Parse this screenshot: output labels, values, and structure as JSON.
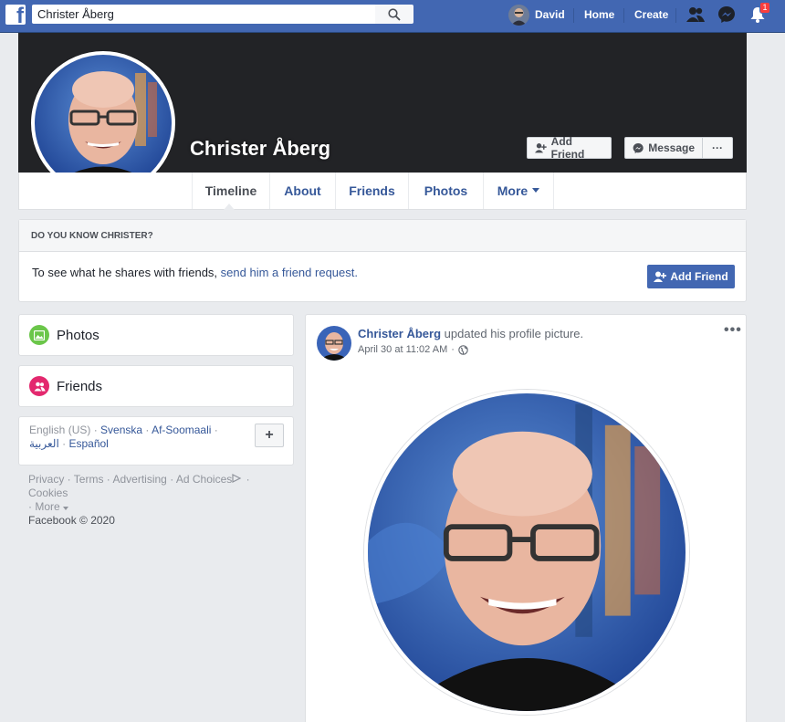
{
  "topbar": {
    "logo": "f",
    "search_value": "Christer Åberg",
    "user_name": "David",
    "home": "Home",
    "create": "Create",
    "notification_count": "1",
    "icons": [
      "search-icon",
      "friend-requests-icon",
      "messenger-icon",
      "notifications-icon"
    ],
    "brand_color": "#4267b2"
  },
  "profile": {
    "name": "Christer Åberg",
    "add_friend": "Add Friend",
    "message": "Message",
    "more_dots": "···"
  },
  "tabs": [
    "Timeline",
    "About",
    "Friends",
    "Photos",
    "More"
  ],
  "know": {
    "heading": "DO YOU KNOW CHRISTER?",
    "text": "To see what he shares with friends, ",
    "link": "send him a friend request.",
    "button": "Add Friend"
  },
  "left": {
    "photos": "Photos",
    "friends": "Friends",
    "languages": {
      "current": "English (US)",
      "others": [
        "Svenska",
        "Af-Soomaali",
        "العربية",
        "Español"
      ],
      "plus": "+"
    },
    "footer_links": [
      "Privacy",
      "Terms",
      "Advertising",
      "Ad Choices",
      "Cookies",
      "More"
    ],
    "copyright": "Facebook © 2020"
  },
  "post": {
    "author": "Christer Åberg",
    "action": " updated his profile picture.",
    "time": "April 30 at 11:02 AM",
    "menu": "•••"
  }
}
